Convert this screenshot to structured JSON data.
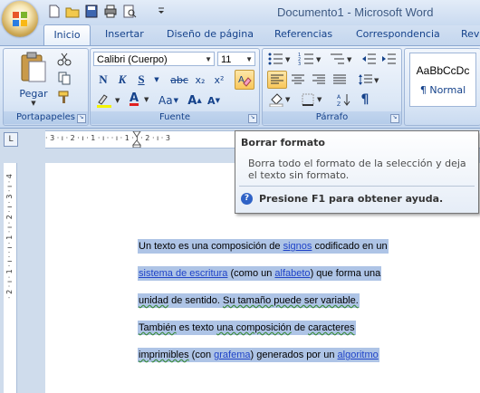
{
  "window": {
    "title": "Documento1 - Microsoft Word"
  },
  "tabs": [
    "Inicio",
    "Insertar",
    "Diseño de página",
    "Referencias",
    "Correspondencia",
    "Revi"
  ],
  "ribbon": {
    "clipboard": {
      "label": "Portapapeles",
      "paste_label": "Pegar"
    },
    "font": {
      "label": "Fuente",
      "font_name": "Calibri (Cuerpo)",
      "font_size": "11",
      "bold": "N",
      "italic": "K",
      "underline": "S",
      "strike": "abc",
      "subscript": "x₂",
      "superscript": "x²",
      "case": "Aa",
      "grow": "A",
      "shrink": "A",
      "color_letter": "A"
    },
    "paragraph": {
      "label": "Párrafo",
      "show_marks": "¶"
    },
    "styles": {
      "preview": "AaBbCcDc",
      "name": "¶ Normal"
    }
  },
  "ruler": {
    "corner": "L",
    "marks": "· 3 · ı · 2 · ı · 1 · ı ·    · ı · 1 · ı · 2 · ı · 3",
    "vertical": "· 2 · ı · 1 · ı ·   · ı · 1 · ı · 2 · ı · 3 · ı · 4"
  },
  "tooltip": {
    "title": "Borrar formato",
    "body": "Borra todo el formato de la selección y deja el texto sin formato.",
    "help": "Presione F1 para obtener ayuda.",
    "help_icon": "?"
  },
  "document": {
    "lines": [
      [
        {
          "t": "Un texto es una composición de ",
          "s": ""
        },
        {
          "t": "signos",
          "s": "link"
        },
        {
          "t": " codificado en un",
          "s": ""
        }
      ],
      [
        {
          "t": "sistema de escritura",
          "s": "link"
        },
        {
          "t": " (como un ",
          "s": ""
        },
        {
          "t": "alfabeto",
          "s": "link"
        },
        {
          "t": ") que forma una",
          "s": ""
        }
      ],
      [
        {
          "t": "unidad",
          "s": "squig"
        },
        {
          "t": " de sentido. ",
          "s": ""
        },
        {
          "t": "Su tamaño puede ser variable.",
          "s": "squig"
        }
      ],
      [
        {
          "t": "También",
          "s": "squig"
        },
        {
          "t": " es texto ",
          "s": ""
        },
        {
          "t": "una composición",
          "s": "squig"
        },
        {
          "t": " de ",
          "s": ""
        },
        {
          "t": "caracteres",
          "s": "squig"
        }
      ],
      [
        {
          "t": "imprimibles",
          "s": "squig"
        },
        {
          "t": " (con ",
          "s": ""
        },
        {
          "t": "grafema",
          "s": "link"
        },
        {
          "t": ") generados por un ",
          "s": ""
        },
        {
          "t": "algoritmo",
          "s": "link"
        }
      ]
    ]
  },
  "colors": {
    "accent": "#15428b",
    "selection": "#aec4e6",
    "link": "#1f43c8"
  }
}
